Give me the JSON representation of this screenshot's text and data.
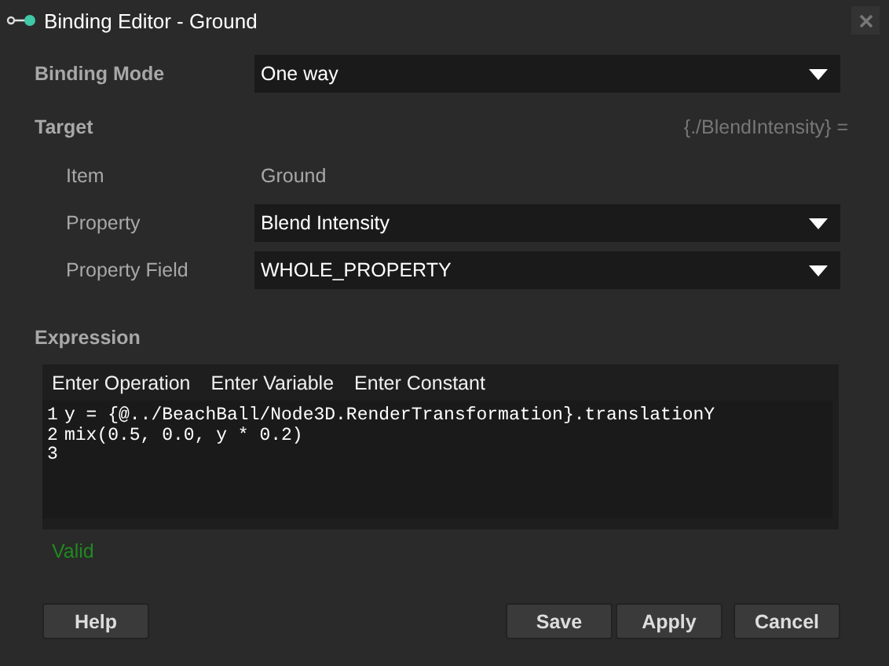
{
  "window": {
    "title": "Binding Editor - Ground"
  },
  "binding_mode": {
    "label": "Binding Mode",
    "value": "One way"
  },
  "target": {
    "heading": "Target",
    "path": "{./BlendIntensity} =",
    "rows": [
      {
        "kind": "text",
        "label": "Item",
        "value": "Ground"
      },
      {
        "kind": "dropdown",
        "label": "Property",
        "value": "Blend Intensity"
      },
      {
        "kind": "dropdown",
        "label": "Property Field",
        "value": "WHOLE_PROPERTY"
      }
    ]
  },
  "expression": {
    "heading": "Expression",
    "toolbar": [
      "Enter Operation",
      "Enter Variable",
      "Enter Constant"
    ],
    "lines": [
      {
        "number": "1",
        "code": "y = {@../BeachBall/Node3D.RenderTransformation}.translationY"
      },
      {
        "number": "2",
        "code": "mix(0.5, 0.0, y * 0.2)"
      },
      {
        "number": "3"
      }
    ]
  },
  "validation": {
    "kind": "valid",
    "text": "Valid"
  },
  "buttons": {
    "left": [
      "Help"
    ],
    "right": [
      "Save",
      "Apply",
      "Cancel"
    ]
  }
}
